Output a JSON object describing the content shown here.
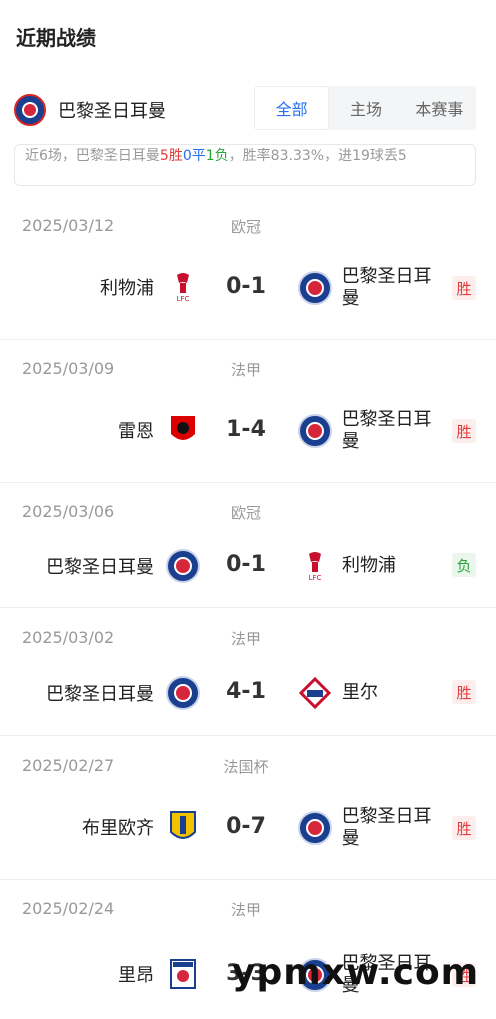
{
  "section": {
    "title": "近期战绩"
  },
  "team": {
    "name": "巴黎圣日耳曼"
  },
  "tabs": [
    {
      "label": "全部",
      "active": true
    },
    {
      "label": "主场",
      "active": false
    },
    {
      "label": "本赛事",
      "active": false
    }
  ],
  "summary": {
    "prefix": "近6场，巴黎圣日耳曼",
    "wins": "5胜",
    "draws": "0平",
    "losses": "1负",
    "suffix": "，胜率83.33%，进19球丢5"
  },
  "matches": [
    {
      "date": "2025/03/12",
      "competition": "欧冠",
      "home": "利物浦",
      "score": "0-1",
      "away": "巴黎圣日耳曼",
      "result": "胜"
    },
    {
      "date": "2025/03/09",
      "competition": "法甲",
      "home": "雷恩",
      "score": "1-4",
      "away": "巴黎圣日耳曼",
      "result": "胜"
    },
    {
      "date": "2025/03/06",
      "competition": "欧冠",
      "home": "巴黎圣日耳曼",
      "score": "0-1",
      "away": "利物浦",
      "result": "负"
    },
    {
      "date": "2025/03/02",
      "competition": "法甲",
      "home": "巴黎圣日耳曼",
      "score": "4-1",
      "away": "里尔",
      "result": "胜"
    },
    {
      "date": "2025/02/27",
      "competition": "法国杯",
      "home": "布里欧齐",
      "score": "0-7",
      "away": "巴黎圣日耳曼",
      "result": "胜"
    },
    {
      "date": "2025/02/24",
      "competition": "法甲",
      "home": "里昂",
      "score": "3-3",
      "away": "巴黎圣日耳曼",
      "result": "胜"
    }
  ],
  "watermark": "ypmxw.com",
  "colors": {
    "win": "#e23b3b",
    "loss": "#29a33c",
    "draw": "#2a6ff0",
    "accent": "#2a6ff0"
  }
}
